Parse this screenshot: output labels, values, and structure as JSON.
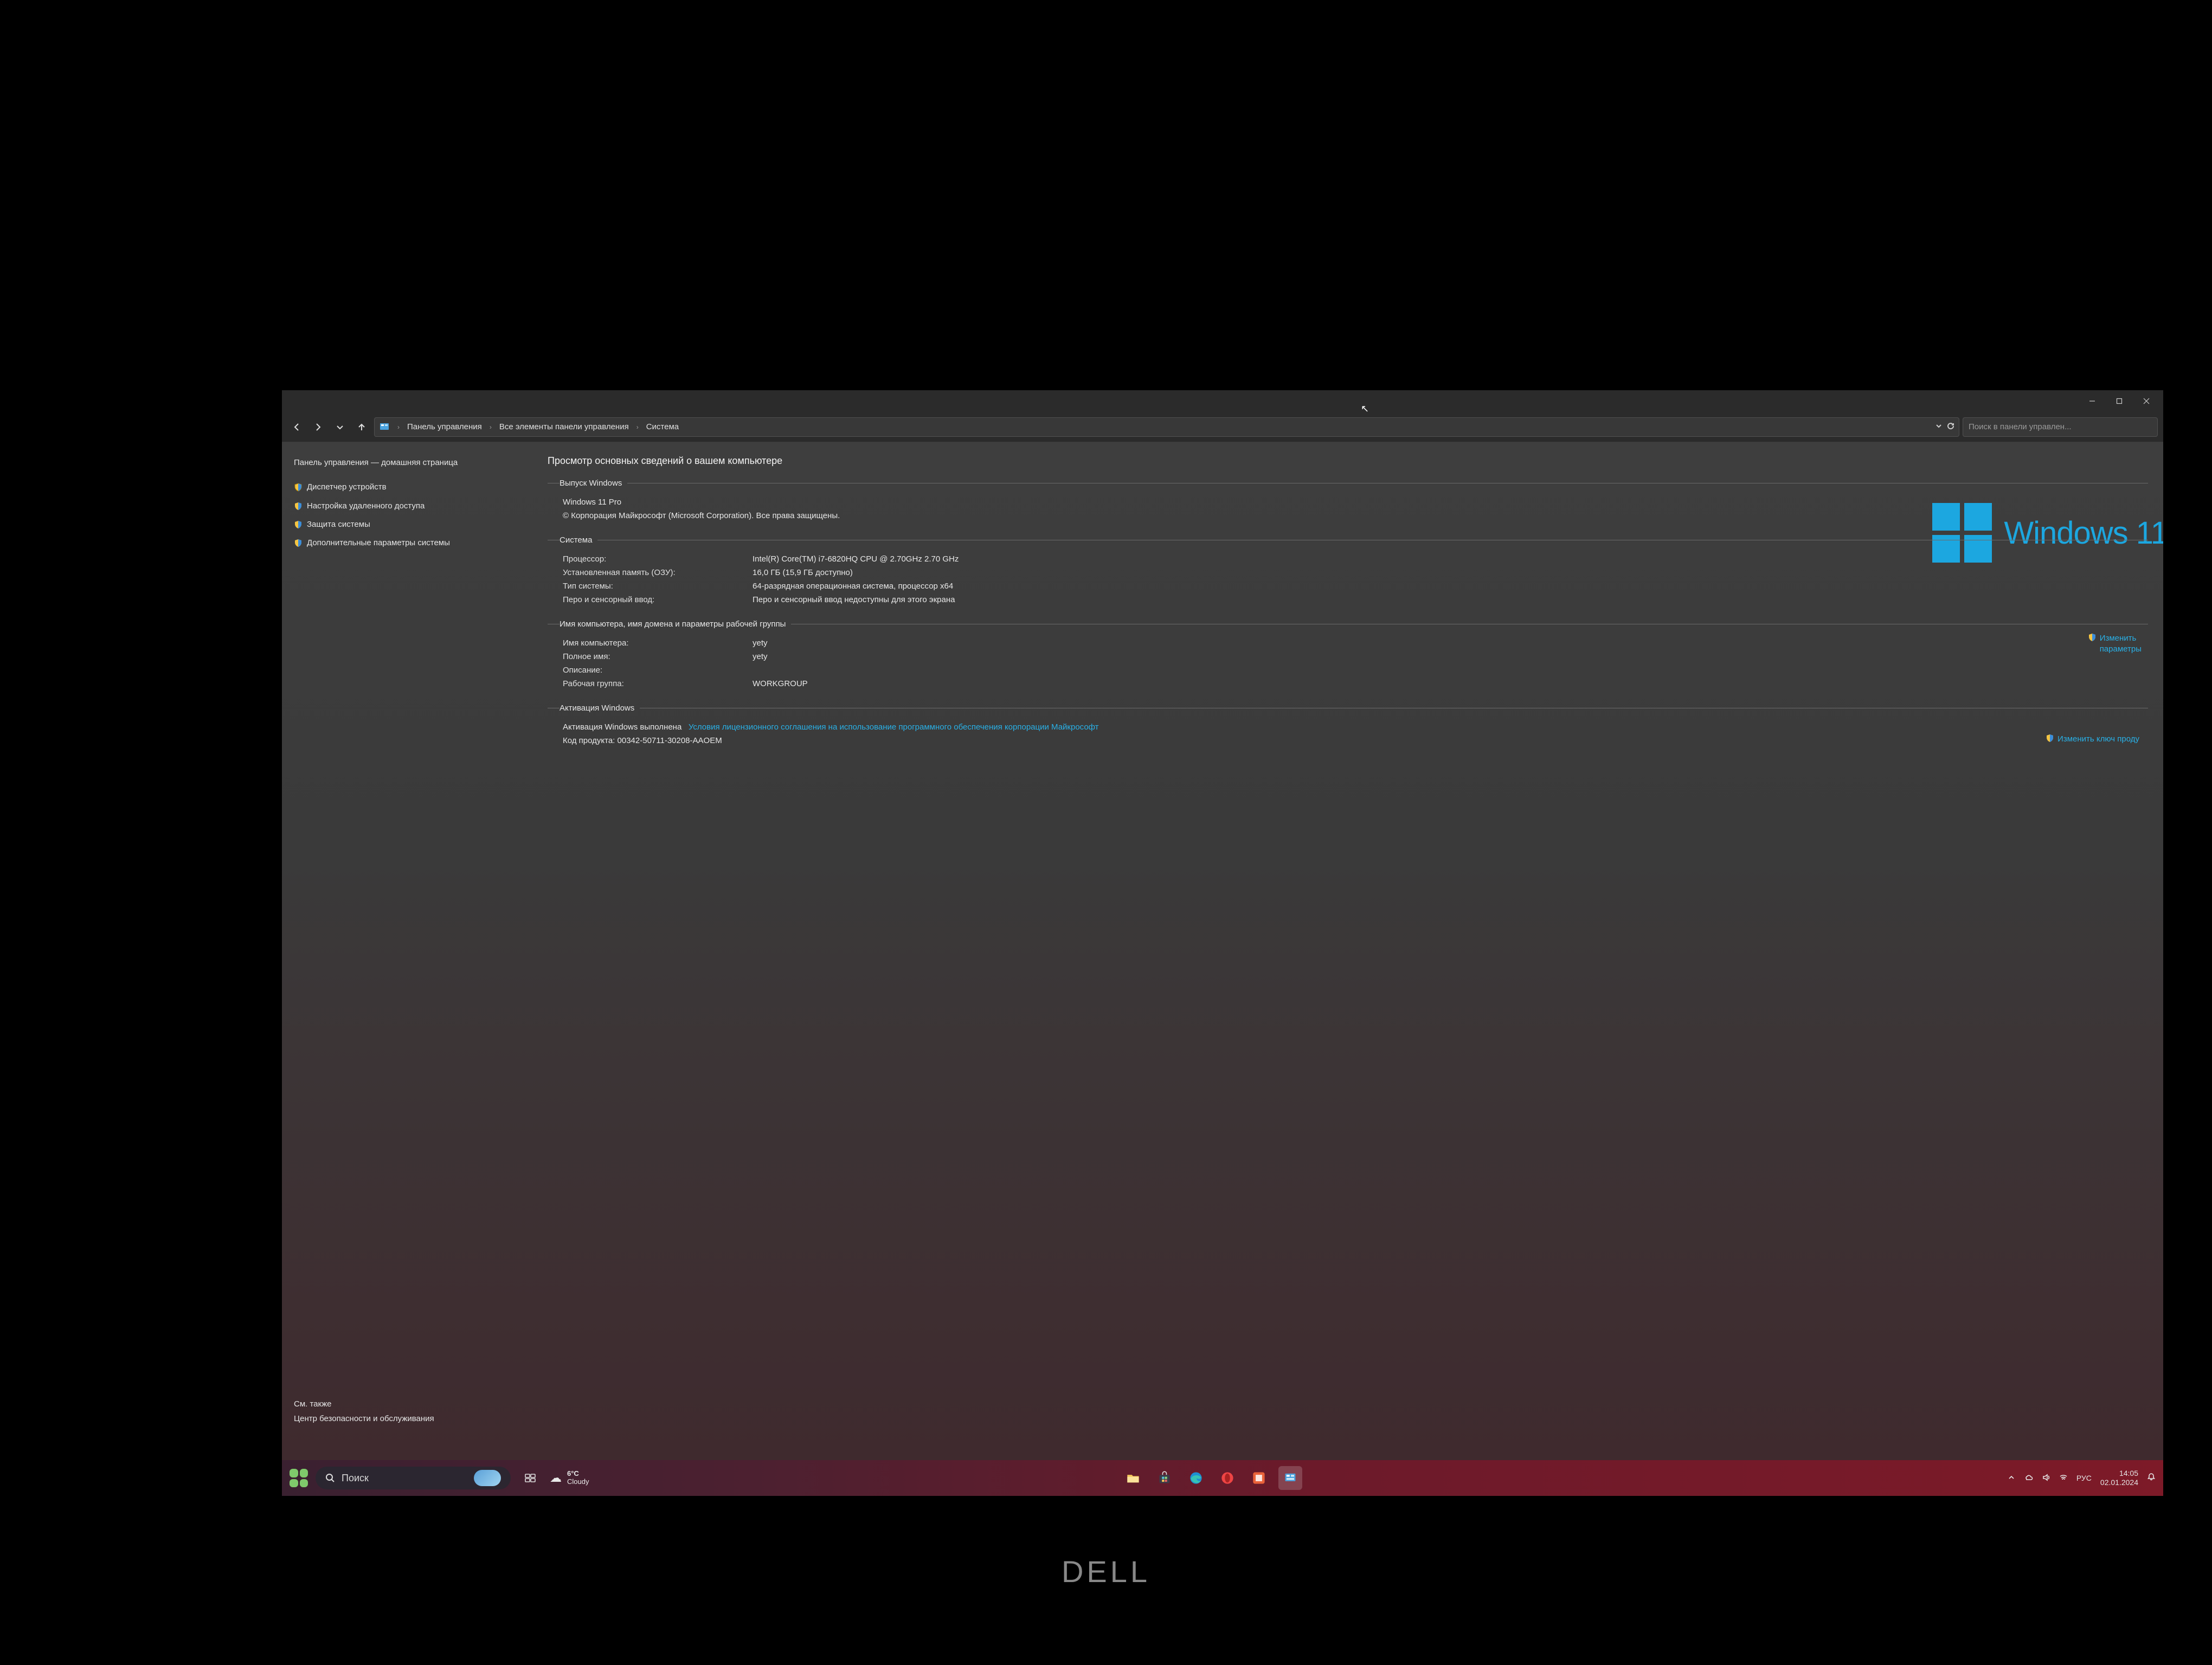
{
  "titlebar": {},
  "nav": {
    "breadcrumb": [
      "Панель управления",
      "Все элементы панели управления",
      "Система"
    ],
    "search_placeholder": "Поиск в панели управлен..."
  },
  "sidebar": {
    "home": "Панель управления — домашняя страница",
    "links": [
      "Диспетчер устройств",
      "Настройка удаленного доступа",
      "Защита системы",
      "Дополнительные параметры системы"
    ],
    "see_also_hdr": "См. также",
    "see_also_link": "Центр безопасности и обслуживания"
  },
  "content": {
    "heading": "Просмотр основных сведений о вашем компьютере",
    "winlogo_text": "Windows 11",
    "group_edition_title": "Выпуск Windows",
    "edition": "Windows 11 Pro",
    "copyright": "© Корпорация Майкрософт (Microsoft Corporation). Все права защищены.",
    "group_system_title": "Система",
    "sys_rows": [
      {
        "label": "Процессор:",
        "value": "Intel(R) Core(TM) i7-6820HQ CPU @ 2.70GHz   2.70 GHz"
      },
      {
        "label": "Установленная память (ОЗУ):",
        "value": "16,0 ГБ (15,9 ГБ доступно)"
      },
      {
        "label": "Тип системы:",
        "value": "64-разрядная операционная система, процессор x64"
      },
      {
        "label": "Перо и сенсорный ввод:",
        "value": "Перо и сенсорный ввод недоступны для этого экрана"
      }
    ],
    "group_name_title": "Имя компьютера, имя домена и параметры рабочей группы",
    "name_rows": [
      {
        "label": "Имя компьютера:",
        "value": "yety"
      },
      {
        "label": "Полное имя:",
        "value": "yety"
      },
      {
        "label": "Описание:",
        "value": ""
      },
      {
        "label": "Рабочая группа:",
        "value": "WORKGROUP"
      }
    ],
    "change_settings": [
      "Изменить",
      "параметры"
    ],
    "group_activation_title": "Активация Windows",
    "activation_status": "Активация Windows выполнена",
    "activation_link": "Условия лицензионного соглашения на использование программного обеспечения корпорации Майкрософт",
    "product_id_label": "Код продукта:",
    "product_id": "00342-50711-30208-AAOEM",
    "change_key": "Изменить ключ проду"
  },
  "taskbar": {
    "search_placeholder": "Поиск",
    "weather_temp": "6°C",
    "weather_desc": "Cloudy",
    "lang": "РУС",
    "time": "14:05",
    "date": "02.01.2024"
  },
  "brand": "DELL"
}
